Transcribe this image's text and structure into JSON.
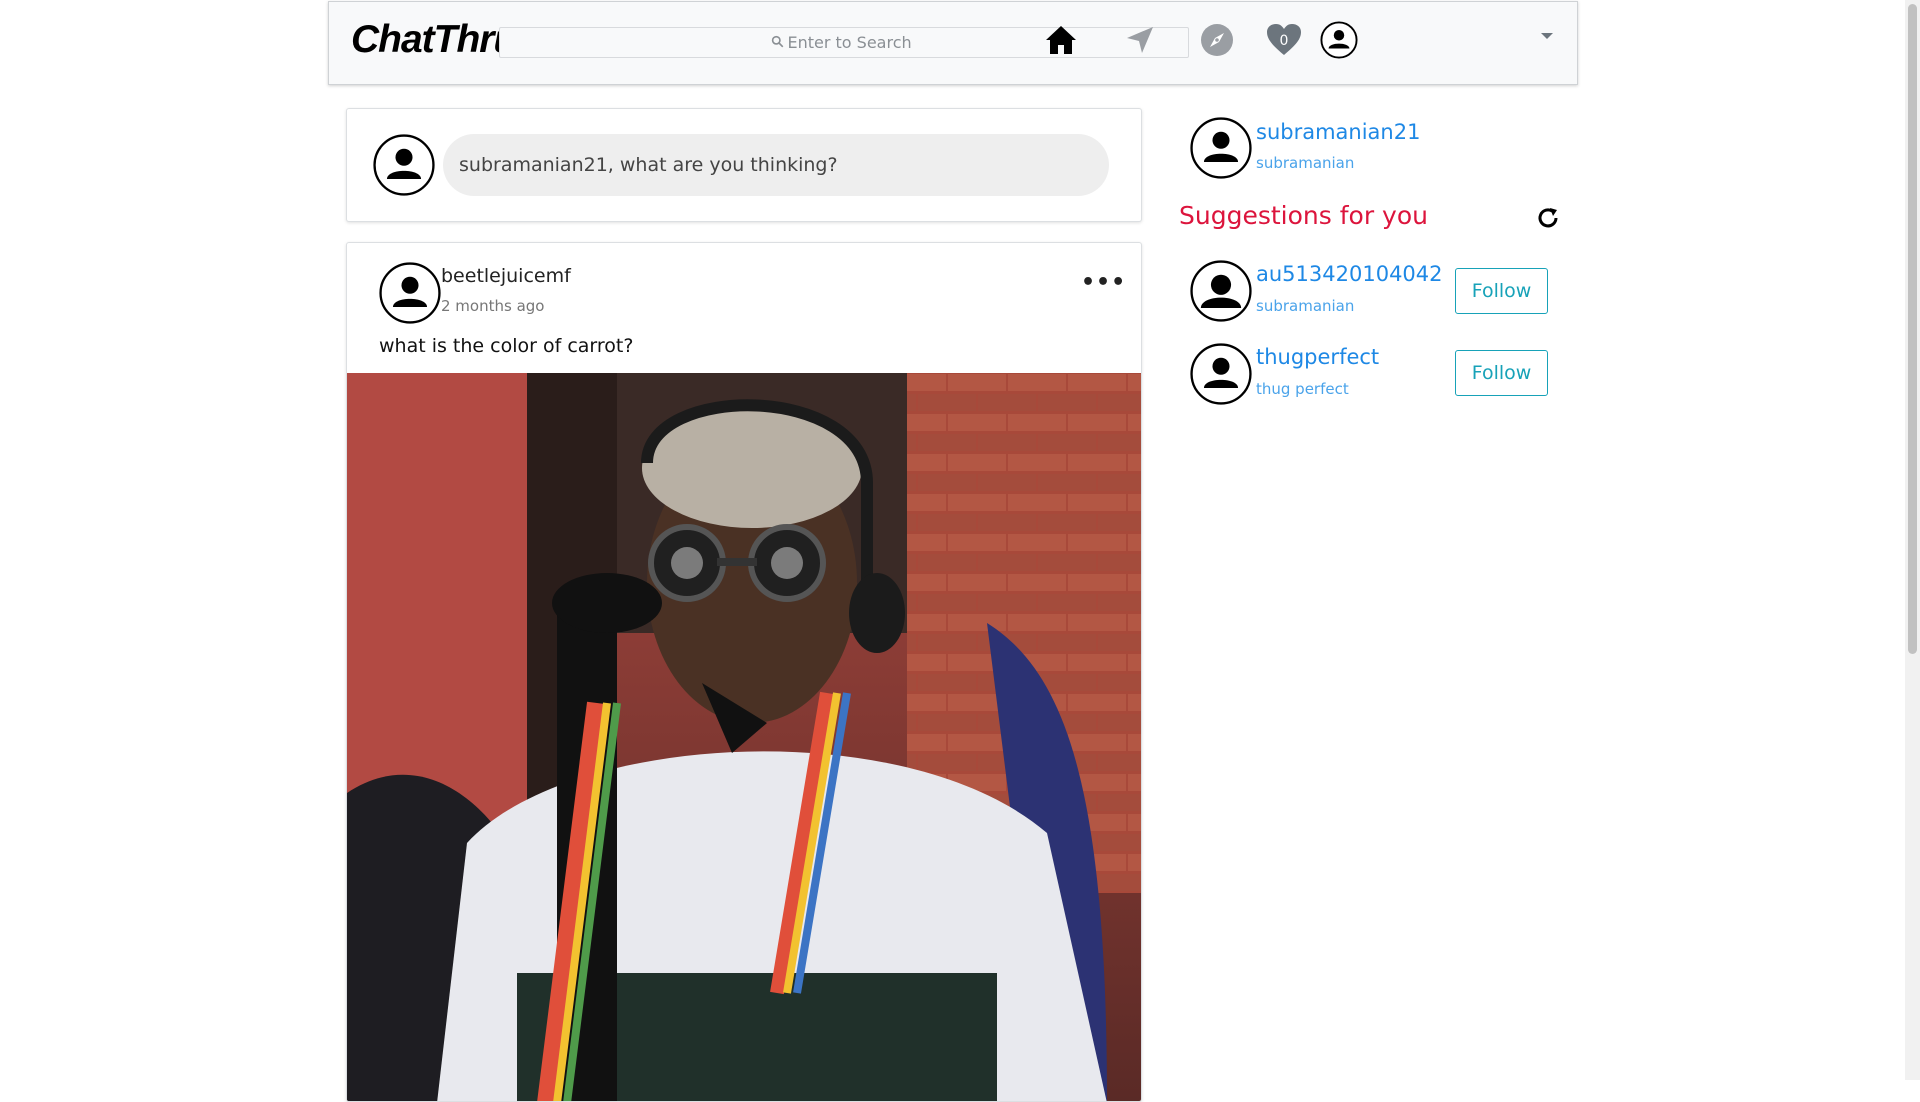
{
  "navbar": {
    "brand": "ChatThru",
    "search_placeholder": "Enter to Search",
    "notifications_count": "0",
    "icons": [
      "home-icon",
      "send-icon",
      "compass-icon",
      "heart-icon",
      "user-avatar-icon",
      "caret-down-icon"
    ]
  },
  "composer": {
    "placeholder": "subramanian21, what are you thinking?"
  },
  "post": {
    "author": "beetlejuicemf",
    "time": "2 months ago",
    "text": "what is the color of carrot?",
    "more": "•••"
  },
  "sidebar": {
    "me": {
      "username": "subramanian21",
      "name": "subramanian"
    },
    "suggestions_title": "Suggestions for you",
    "suggestions": [
      {
        "username": "au513420104042",
        "name": "subramanian",
        "button": "Follow"
      },
      {
        "username": "thugperfect",
        "name": "thug perfect",
        "button": "Follow"
      }
    ]
  },
  "colors": {
    "link": "#1e88e5",
    "accent_red": "#dc143c",
    "follow_teal": "#17a2b8"
  }
}
